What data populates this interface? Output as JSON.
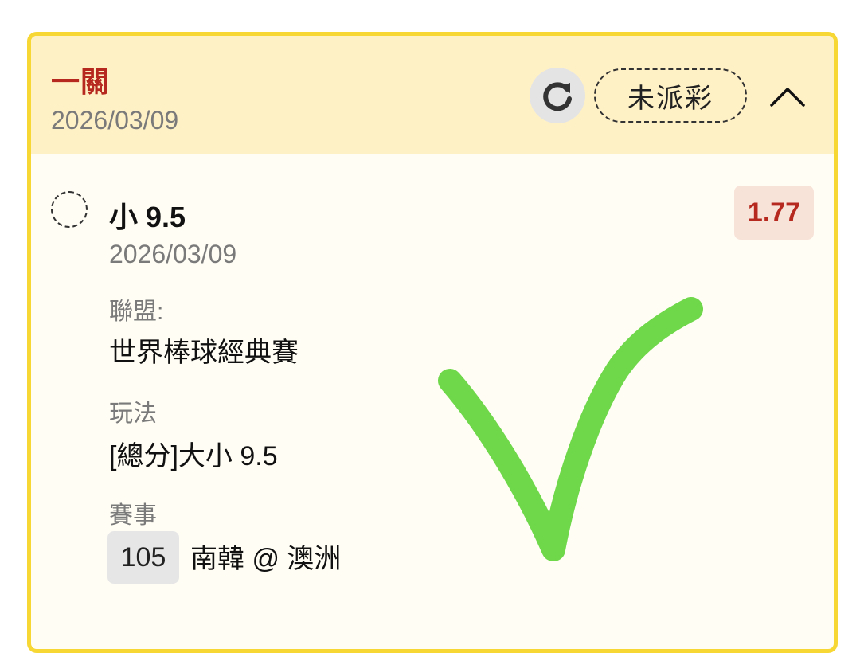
{
  "header": {
    "title": "一關",
    "date": "2026/03/09",
    "status_label": "未派彩"
  },
  "selection": {
    "name": "小 9.5",
    "date": "2026/03/09",
    "odds": "1.77"
  },
  "details": {
    "league_label": "聯盟:",
    "league_value": "世界棒球經典賽",
    "bet_type_label": "玩法",
    "bet_type_value": "[總分]大小 9.5",
    "match_label": "賽事",
    "match_number": "105",
    "match_teams": "南韓 @ 澳洲"
  },
  "icons": {
    "refresh": "refresh-icon",
    "collapse": "chevron-up-icon",
    "checkmark": "checkmark-icon"
  },
  "colors": {
    "border": "#f6d733",
    "header_bg": "#fff1c6",
    "accent_red": "#b5291e",
    "check_green": "#6fd84a"
  }
}
